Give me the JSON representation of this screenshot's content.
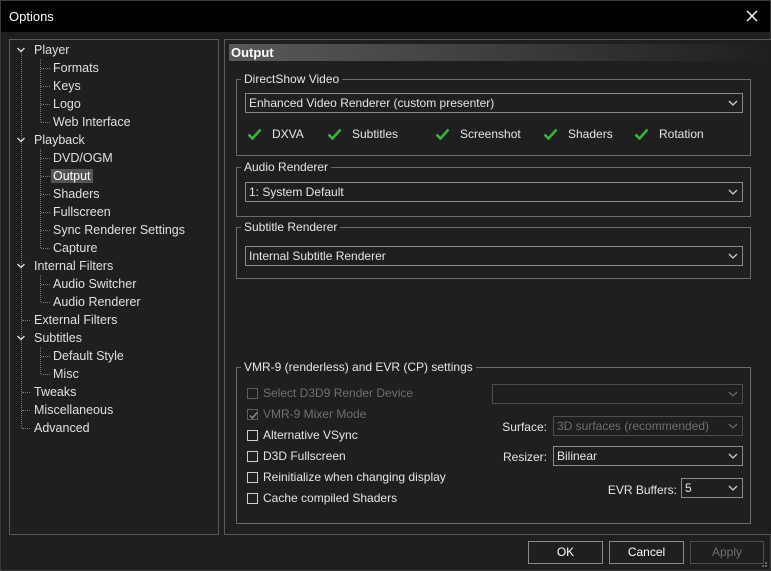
{
  "window": {
    "title": "Options"
  },
  "tree": {
    "items": [
      {
        "label": "Player",
        "level": 0,
        "expanded": true
      },
      {
        "label": "Formats",
        "level": 1
      },
      {
        "label": "Keys",
        "level": 1
      },
      {
        "label": "Logo",
        "level": 1
      },
      {
        "label": "Web Interface",
        "level": 1
      },
      {
        "label": "Playback",
        "level": 0,
        "expanded": true
      },
      {
        "label": "DVD/OGM",
        "level": 1
      },
      {
        "label": "Output",
        "level": 1,
        "selected": true
      },
      {
        "label": "Shaders",
        "level": 1
      },
      {
        "label": "Fullscreen",
        "level": 1
      },
      {
        "label": "Sync Renderer Settings",
        "level": 1
      },
      {
        "label": "Capture",
        "level": 1
      },
      {
        "label": "Internal Filters",
        "level": 0,
        "expanded": true
      },
      {
        "label": "Audio Switcher",
        "level": 1
      },
      {
        "label": "Audio Renderer",
        "level": 1
      },
      {
        "label": "External Filters",
        "level": 0
      },
      {
        "label": "Subtitles",
        "level": 0,
        "expanded": true
      },
      {
        "label": "Default Style",
        "level": 1
      },
      {
        "label": "Misc",
        "level": 1
      },
      {
        "label": "Tweaks",
        "level": 0
      },
      {
        "label": "Miscellaneous",
        "level": 0
      },
      {
        "label": "Advanced",
        "level": 0
      }
    ]
  },
  "page": {
    "header": "Output",
    "directshow": {
      "legend": "DirectShow Video",
      "selected": "Enhanced Video Renderer (custom presenter)",
      "capabilities": [
        "DXVA",
        "Subtitles",
        "Screenshot",
        "Shaders",
        "Rotation"
      ]
    },
    "audio": {
      "legend": "Audio Renderer",
      "selected": "1: System Default"
    },
    "subtitle": {
      "legend": "Subtitle Renderer",
      "selected": "Internal Subtitle Renderer"
    },
    "vmr": {
      "legend": "VMR-9 (renderless) and EVR (CP) settings",
      "options": [
        {
          "label": "Select D3D9 Render Device",
          "checked": false,
          "enabled": false
        },
        {
          "label": "VMR-9 Mixer Mode",
          "checked": true,
          "enabled": false
        },
        {
          "label": "Alternative VSync",
          "checked": false,
          "enabled": true
        },
        {
          "label": "D3D Fullscreen",
          "checked": false,
          "enabled": true
        },
        {
          "label": "Reinitialize when changing display",
          "checked": false,
          "enabled": true
        },
        {
          "label": "Cache compiled Shaders",
          "checked": false,
          "enabled": true
        }
      ],
      "device": "",
      "surface_label": "Surface:",
      "surface": "3D surfaces (recommended)",
      "resizer_label": "Resizer:",
      "resizer": "Bilinear",
      "evr_label": "EVR Buffers:",
      "evr_buffers": "5"
    }
  },
  "buttons": {
    "ok": "OK",
    "cancel": "Cancel",
    "apply": "Apply"
  },
  "colors": {
    "check_green": "#3fae3f",
    "selection": "#545454"
  }
}
